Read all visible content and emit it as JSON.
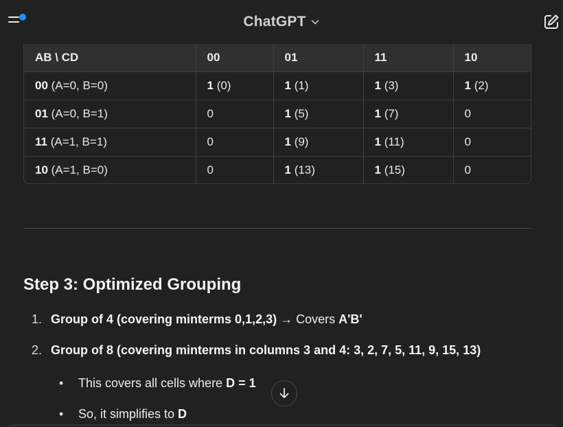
{
  "header": {
    "title": "ChatGPT",
    "accent_dot_color": "#1e90ff"
  },
  "table": {
    "headers": [
      "AB \\ CD",
      "00",
      "01",
      "11",
      "10"
    ],
    "rows": [
      [
        {
          "bold": "00",
          "rest": " (A=0, B=0)"
        },
        {
          "bold": "1",
          "rest": " (0)"
        },
        {
          "bold": "1",
          "rest": " (1)"
        },
        {
          "bold": "1",
          "rest": " (3)"
        },
        {
          "bold": "1",
          "rest": " (2)"
        }
      ],
      [
        {
          "bold": "01",
          "rest": " (A=0, B=1)"
        },
        {
          "bold": "",
          "rest": "0"
        },
        {
          "bold": "1",
          "rest": " (5)"
        },
        {
          "bold": "1",
          "rest": " (7)"
        },
        {
          "bold": "",
          "rest": "0"
        }
      ],
      [
        {
          "bold": "11",
          "rest": " (A=1, B=1)"
        },
        {
          "bold": "",
          "rest": "0"
        },
        {
          "bold": "1",
          "rest": " (9)"
        },
        {
          "bold": "1",
          "rest": " (11)"
        },
        {
          "bold": "",
          "rest": "0"
        }
      ],
      [
        {
          "bold": "10",
          "rest": " (A=1, B=0)"
        },
        {
          "bold": "",
          "rest": "0"
        },
        {
          "bold": "1",
          "rest": " (13)"
        },
        {
          "bold": "1",
          "rest": " (15)"
        },
        {
          "bold": "",
          "rest": "0"
        }
      ]
    ]
  },
  "section": {
    "heading": "Step 3: Optimized Grouping",
    "steps": [
      {
        "num": "1.",
        "bold": "Group of 4 (covering minterms 0,1,2,3)",
        "middle": " → Covers ",
        "bold2": "A'B'"
      },
      {
        "num": "2.",
        "bold": "Group of 8 (covering minterms in columns 3 and 4: 3, 2, 7, 5, 11, 9, 15, 13)",
        "middle": "",
        "bold2": ""
      }
    ],
    "bullets": [
      {
        "text": "This covers all cells where ",
        "bold": "D = 1"
      },
      {
        "text": "So, it simplifies to ",
        "bold": "D"
      }
    ]
  },
  "icons": {
    "menu": "sidebar-menu-icon",
    "chevron": "chevron-down-icon",
    "new_chat": "new-chat-icon",
    "scroll_down": "arrow-down-icon"
  }
}
